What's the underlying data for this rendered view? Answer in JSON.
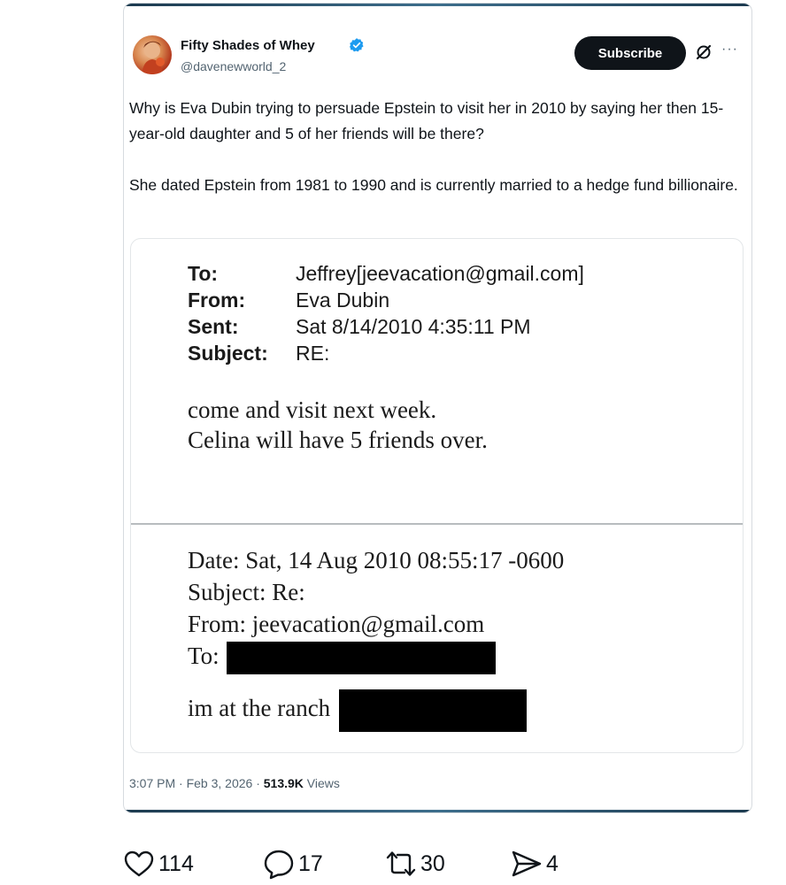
{
  "tweet": {
    "display_name": "Fifty Shades of Whey",
    "handle": "@davenewworld_2",
    "verified_icon": "verified-badge-icon",
    "subscribe_label": "Subscribe",
    "more_label": "···",
    "text": [
      "Why is Eva Dubin trying to persuade Epstein to visit her in 2010 by saying her then 15-year-old daughter and 5 of her friends will be there?",
      "She dated Epstein from 1981 to 1990 and is currently married to a hedge fund billionaire."
    ],
    "timestamp_prefix": "3:07 PM · Feb 3, 2026 · ",
    "views_count": "513.9K",
    "views_label": " Views"
  },
  "email": {
    "headers": [
      {
        "key": "To:",
        "value": "Jeffrey[jeevacation@gmail.com]"
      },
      {
        "key": "From:",
        "value": "Eva Dubin"
      },
      {
        "key": "Sent:",
        "value": "Sat 8/14/2010 4:35:11 PM"
      },
      {
        "key": "Subject:",
        "value": "RE:"
      }
    ],
    "body": [
      "come and visit next week.",
      "Celina will have 5 friends over."
    ],
    "quoted": {
      "date": "Date: Sat, 14 Aug 2010 08:55:17 -0600",
      "subject": "Subject: Re:",
      "from": "From: jeevacation@gmail.com",
      "to_label": "To:",
      "body_prefix": "im at the ranch"
    }
  },
  "actions": {
    "likes": "114",
    "replies": "17",
    "reposts": "30",
    "shares": "4"
  }
}
